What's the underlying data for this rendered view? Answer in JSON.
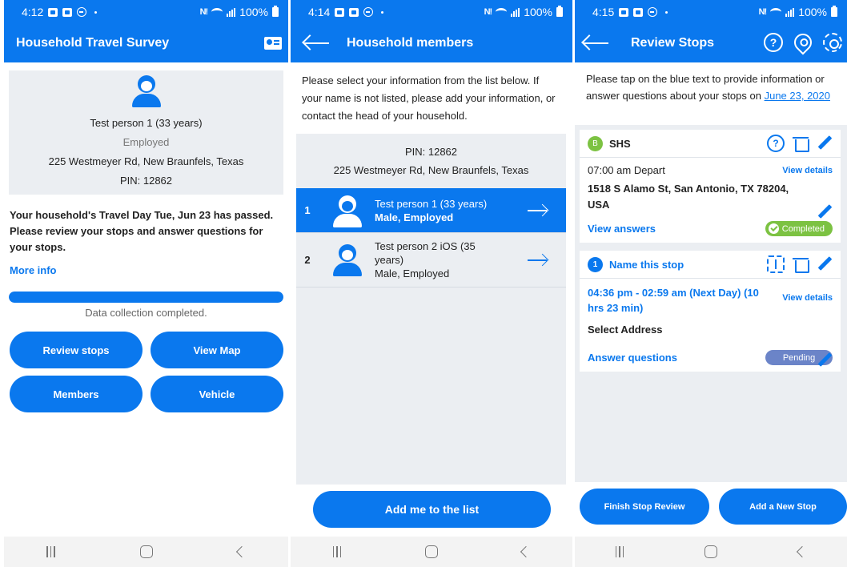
{
  "screen1": {
    "status": {
      "time": "4:12",
      "battery_pct": "100%"
    },
    "appbar": {
      "title": "Household Travel Survey",
      "icon": "contact-card-icon"
    },
    "profile": {
      "name": "Test person 1 (33 years)",
      "employment": "Employed",
      "address": "225 Westmeyer Rd, New Braunfels, Texas",
      "pin": "PIN: 12862"
    },
    "notice": "Your household's Travel Day Tue, Jun 23 has passed. Please review your stops and answer questions for your stops.",
    "more_info": "More info",
    "progress": {
      "value_pct": 100,
      "label": "Data collection completed."
    },
    "buttons": {
      "review_stops": "Review stops",
      "view_map": "View Map",
      "members": "Members",
      "vehicle": "Vehicle"
    }
  },
  "screen2": {
    "status": {
      "time": "4:14",
      "battery_pct": "100%"
    },
    "appbar": {
      "title": "Household members"
    },
    "intro": "Please select your information from the list below. If your name is not listed, please add your information, or contact the head of your household.",
    "pin": "PIN: 12862",
    "address": "225 Westmeyer Rd, New Braunfels, Texas",
    "members": [
      {
        "num": "1",
        "name": "Test person 1 (33 years)",
        "detail": "Male, Employed",
        "selected": true
      },
      {
        "num": "2",
        "name": "Test person 2 iOS (35 years)",
        "detail": "Male, Employed",
        "selected": false
      }
    ],
    "add_button": "Add me to the list"
  },
  "screen3": {
    "status": {
      "time": "4:15",
      "battery_pct": "100%"
    },
    "appbar": {
      "title": "Review Stops",
      "help_glyph": "?"
    },
    "intro_prefix": "Please tap on the blue text to provide information or answer questions about your stops on ",
    "intro_date": "June 23, 2020",
    "stops": [
      {
        "badge": "B",
        "name": "SHS",
        "time": "07:00 am Depart",
        "view_details": "View details",
        "address": "1518 S Alamo St, San Antonio, TX 78204, USA",
        "action": "View answers",
        "status": "Completed",
        "help_glyph": "?"
      },
      {
        "badge": "1",
        "name": "Name this stop",
        "time": "04:36 pm - 02:59 am (Next Day)  (10 hrs 23 min)",
        "view_details": "View details",
        "address": "Select Address",
        "action": "Answer questions",
        "status": "Pending"
      }
    ],
    "buttons": {
      "finish": "Finish Stop Review",
      "add_stop": "Add a New Stop"
    }
  },
  "colors": {
    "primary": "#0a78ee",
    "panel": "#ebeef2",
    "completed": "#7cc242",
    "pending": "#6b84c8"
  }
}
